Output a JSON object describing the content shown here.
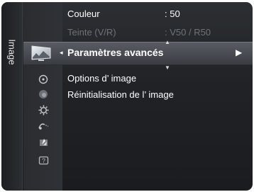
{
  "side_tab": {
    "label": "Image"
  },
  "menu": {
    "items": [
      {
        "label": "Couleur",
        "value": ": 50"
      },
      {
        "label": "Teinte (V/R)",
        "value": ": V50 / R50"
      },
      {
        "label": "Paramètres avancés"
      },
      {
        "label": "Options d’ image"
      },
      {
        "label": "Réinitialisation de l’ image"
      }
    ]
  },
  "icons": [
    "tv-picture-icon",
    "sound-icon",
    "channel-icon",
    "setup-icon",
    "input-icon",
    "application-icon",
    "support-icon"
  ],
  "colors": {
    "panel": "#202225",
    "highlight": "#585c62",
    "dim_text": "#6e7278"
  }
}
